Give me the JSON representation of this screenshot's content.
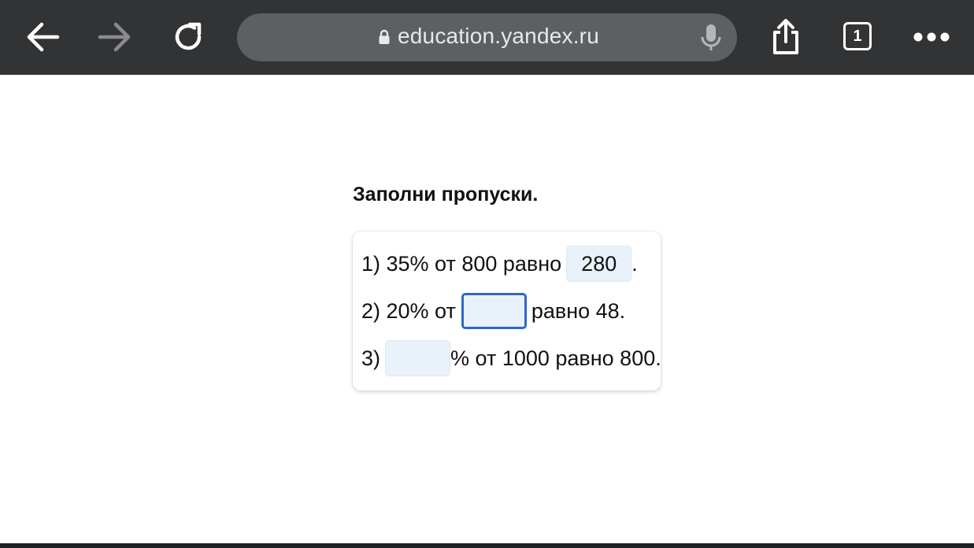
{
  "browser": {
    "url": "education.yandex.ru",
    "tabs_count": "1",
    "icons": [
      "back-arrow-icon",
      "forward-arrow-icon",
      "reload-icon",
      "lock-icon",
      "microphone-icon",
      "share-icon",
      "tabs-icon",
      "more-icon"
    ]
  },
  "task": {
    "title": "Заполни пропуски.",
    "rows": [
      {
        "prefix": "1) 35% от 800 равно",
        "answer": "280",
        "suffix": "."
      },
      {
        "prefix": "2) 20% от",
        "answer": "",
        "suffix": "равно 48."
      },
      {
        "prefix": "3)",
        "answer": "",
        "suffix": "% от 1000 равно 800."
      }
    ]
  },
  "colors": {
    "toolbar_bg": "#323335",
    "urlbar_bg": "#5d5f62",
    "input_bg": "#e9f1fb",
    "focus_border": "#2c67c9"
  }
}
